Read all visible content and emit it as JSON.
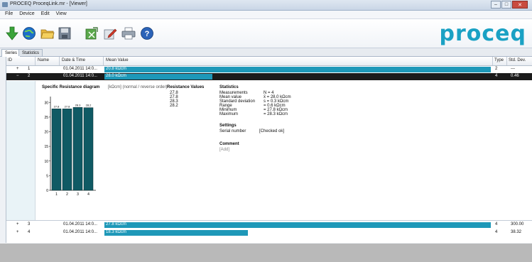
{
  "window": {
    "title": "PROCEQ ProceqLink.mr - [Viewer]",
    "buttons": {
      "minimize": "–",
      "maximize": "□",
      "close": "✕"
    }
  },
  "menu": {
    "items": [
      "File",
      "Device",
      "Edit",
      "View"
    ]
  },
  "toolbar": {
    "icons": [
      "download-arrow-icon",
      "globe-icon",
      "open-folder-icon",
      "save-icon",
      "export-icon",
      "edit-icon",
      "print-icon",
      "help-icon"
    ]
  },
  "brand": {
    "logo_text": "proceq",
    "color": "#1aa1c4"
  },
  "tabs": [
    {
      "label": "Series",
      "active": true
    },
    {
      "label": "Statistics",
      "active": false
    }
  ],
  "table": {
    "headers": {
      "id": "ID",
      "name": "Name",
      "datetime": "Date & Time",
      "mean": "Mean Value",
      "type": "Type",
      "stddev": "Std. Dev."
    },
    "rows": [
      {
        "id": "1",
        "name": "",
        "datetime": "01.04.2011 14:0...",
        "mean": "20.8 kΩcm",
        "bar_fraction": 0.925,
        "bar_color": "#1e98b8",
        "type": "2",
        "stddev": "---",
        "state": "normal"
      },
      {
        "id": "2",
        "name": "",
        "datetime": "01.04.2011 14:0...",
        "mean": "28.0 kΩcm",
        "bar_fraction": 0.26,
        "bar_color": "#1e98b8",
        "type": "4",
        "stddev": "0.46",
        "state": "selected"
      },
      {
        "id": "3",
        "name": "",
        "datetime": "01.04.2011 14:0...",
        "mean": "27.8 kΩcm",
        "bar_fraction": 0.925,
        "bar_color": "#1e98b8",
        "type": "4",
        "stddev": "300.00",
        "state": "normal"
      },
      {
        "id": "4",
        "name": "",
        "datetime": "01.04.2011 14:0...",
        "mean": "18.3 kΩcm",
        "bar_fraction": 0.345,
        "bar_color": "#1e98b8",
        "type": "4",
        "stddev": "38.32",
        "state": "normal"
      }
    ]
  },
  "detail": {
    "chart_title": "Specific Resistance diagram",
    "chart_unit": "[kΩcm] (normal / reverse order)",
    "resistance_title": "Resistance Values",
    "resistance_values": [
      "27.8",
      "27.8",
      "28.3",
      "28.2"
    ],
    "statistics_title": "Statistics",
    "statistics": [
      {
        "label": "Measurements",
        "value": "N = 4"
      },
      {
        "label": "Mean value",
        "value": "x̄ = 28.0 kΩcm"
      },
      {
        "label": "Standard deviation",
        "value": "s = 0.3 kΩcm"
      },
      {
        "label": "Range",
        "value": "= 0.6 kΩcm"
      },
      {
        "label": "Minimum",
        "value": "= 27.8 kΩcm"
      },
      {
        "label": "Maximum",
        "value": "= 28.3 kΩcm"
      }
    ],
    "settings_title": "Settings",
    "settings": [
      {
        "label": "Serial number",
        "value": "[Checked ok]"
      }
    ],
    "comment_title": "Comment",
    "comment_value": "[Add]"
  },
  "chart_data": {
    "type": "bar",
    "categories": [
      "1",
      "2",
      "3",
      "4"
    ],
    "values": [
      27.8,
      27.8,
      28.3,
      28.2
    ],
    "data_labels": [
      "27.8",
      "27.8",
      "28.3",
      "28.2"
    ],
    "ylim": [
      0,
      32
    ],
    "yticks": [
      "0",
      "5",
      "10",
      "15",
      "20",
      "25",
      "30"
    ],
    "bar_color": "#0f5a64"
  }
}
